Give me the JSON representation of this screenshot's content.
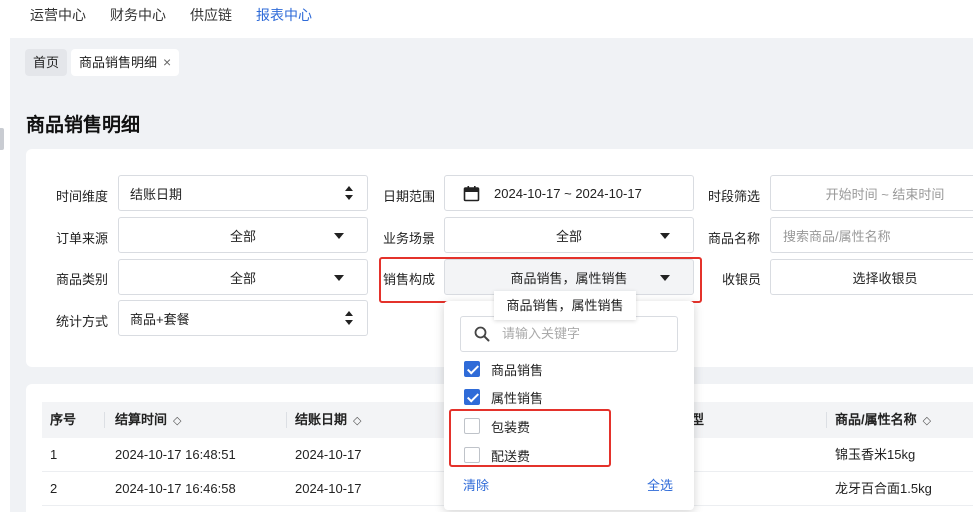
{
  "top_nav": {
    "items": [
      "运营中心",
      "财务中心",
      "供应链",
      "报表中心"
    ]
  },
  "tabs": {
    "home": "首页",
    "current": "商品销售明细",
    "close": "×"
  },
  "page_title": "商品销售明细",
  "filters": {
    "time_dimension": {
      "label": "时间维度",
      "value": "结账日期"
    },
    "date_range": {
      "label": "日期范围",
      "value": "2024-10-17 ~ 2024-10-17"
    },
    "time_slot": {
      "label": "时段筛选",
      "placeholder": "开始时间 ~ 结束时间"
    },
    "order_source": {
      "label": "订单来源",
      "value": "全部"
    },
    "business_scene": {
      "label": "业务场景",
      "value": "全部"
    },
    "product_name": {
      "label": "商品名称",
      "placeholder": "搜索商品/属性名称"
    },
    "product_category": {
      "label": "商品类别",
      "value": "全部"
    },
    "sales_composition": {
      "label": "销售构成",
      "value": "商品销售，属性销售"
    },
    "cashier": {
      "label": "收银员",
      "value": "选择收银员"
    },
    "stat_method": {
      "label": "统计方式",
      "value": "商品+套餐"
    }
  },
  "tooltip": "商品销售，属性销售",
  "dropdown": {
    "search_placeholder": "请输入关键字",
    "options": [
      {
        "label": "商品销售",
        "checked": true
      },
      {
        "label": "属性销售",
        "checked": true
      },
      {
        "label": "包装费",
        "checked": false
      },
      {
        "label": "配送费",
        "checked": false
      }
    ],
    "clear": "清除",
    "select_all": "全选"
  },
  "table": {
    "headers": [
      "序号",
      "结算时间",
      "结账日期",
      "型",
      "商品/属性名称"
    ],
    "sort_icon": "◇",
    "rows": [
      [
        "1",
        "2024-10-17 16:48:51",
        "2024-10-17",
        "锦玉香米15kg"
      ],
      [
        "2",
        "2024-10-17 16:46:58",
        "2024-10-17",
        "龙牙百合面1.5kg"
      ]
    ]
  },
  "colors": {
    "accent": "#2f6bd8",
    "highlight": "#e4322b"
  }
}
